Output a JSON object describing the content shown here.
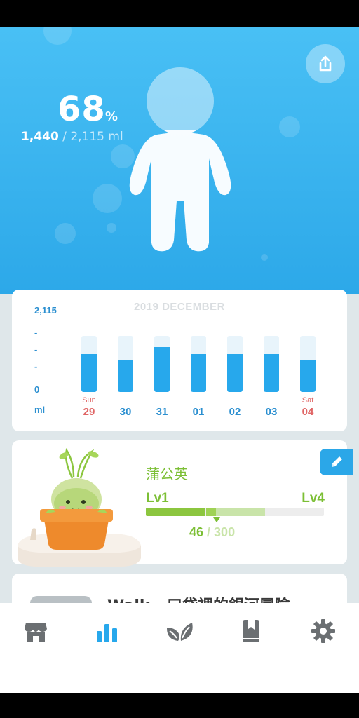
{
  "hero": {
    "percent": "68",
    "percent_sign": "%",
    "current_volume": "1,440",
    "volume_separator": " / ",
    "goal_volume": "2,115 ml",
    "share_icon": "share-icon"
  },
  "chart": {
    "title": "2019 DECEMBER",
    "y_max_label": "2,115",
    "y_min_label": "0",
    "unit_label": "ml",
    "dash_label": "-"
  },
  "chart_data": {
    "type": "bar",
    "title": "2019 DECEMBER",
    "categories": [
      "29",
      "30",
      "31",
      "01",
      "02",
      "03",
      "04"
    ],
    "day_names": [
      "Sun",
      "",
      "",
      "",
      "",
      "",
      "Sat"
    ],
    "values": [
      0.68,
      0.57,
      0.8,
      0.68,
      0.68,
      0.68,
      0.57
    ],
    "value_unit": "fraction of goal (2,115 ml)",
    "ylim": [
      0,
      2115
    ],
    "ylabel": "ml",
    "colors": {
      "fill": "#27a8ec",
      "track": "#e8f4fb",
      "weekend": "#e06666",
      "weekday": "#2b8fd0"
    }
  },
  "plant": {
    "name": "蒲公英",
    "level_start": "Lv1",
    "level_end": "Lv4",
    "xp_current": "46",
    "xp_separator": " / ",
    "xp_total": "300",
    "progress_fraction": 0.153,
    "edit_icon": "pencil-icon"
  },
  "next_card": {
    "title": "Walk - 口袋裡的銀河冒險"
  },
  "tabs": [
    {
      "name": "store",
      "icon": "store-icon"
    },
    {
      "name": "stats",
      "icon": "bar-chart-icon",
      "active": true
    },
    {
      "name": "plants",
      "icon": "leaf-icon"
    },
    {
      "name": "journal",
      "icon": "bookmark-book-icon"
    },
    {
      "name": "settings",
      "icon": "gear-icon"
    }
  ],
  "colors": {
    "accent": "#2ba7e8",
    "plant_green": "#7cbf35",
    "tab_gray": "#6b6f72"
  }
}
